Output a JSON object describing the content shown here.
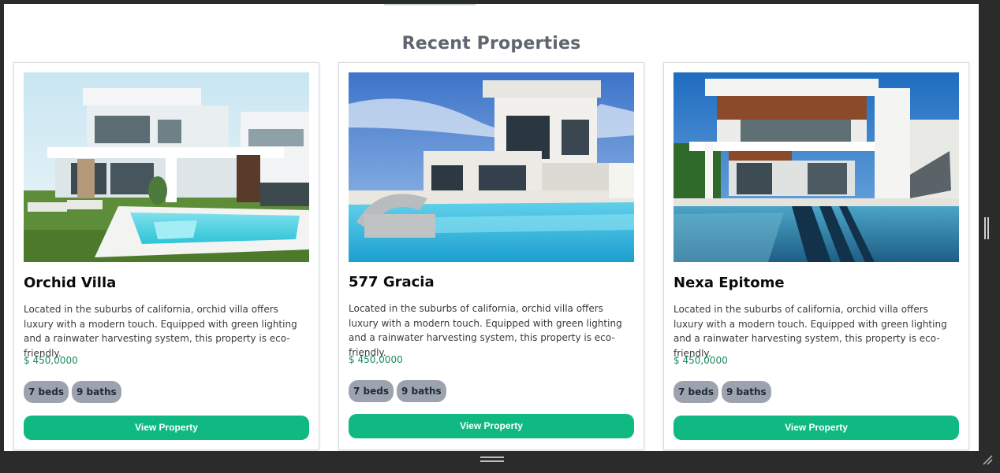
{
  "section_title": "Recent Properties",
  "colors": {
    "button": "#10b981",
    "price": "#1a8a5a",
    "tag_bg": "#9ca3af",
    "title": "#5f6670"
  },
  "properties": [
    {
      "name": "Orchid Villa",
      "description": "Located in the suburbs of california, orchid villa offers luxury with a modern touch. Equipped with green lighting and a rainwater harvesting system, this property is eco-friendly.",
      "price": "$ 450,0000",
      "beds": "7 beds",
      "baths": "9 baths",
      "button_label": "View Property"
    },
    {
      "name": "577 Gracia",
      "description": "Located in the suburbs of california, orchid villa offers luxury with a modern touch. Equipped with green lighting and a rainwater harvesting system, this property is eco-friendly.",
      "price": "$ 450,0000",
      "beds": "7 beds",
      "baths": "9 baths",
      "button_label": "View Property"
    },
    {
      "name": "Nexa Epitome",
      "description": "Located in the suburbs of california, orchid villa offers luxury with a modern touch. Equipped with green lighting and a rainwater harvesting system, this property is eco-friendly.",
      "price": "$ 450,0000",
      "beds": "7 beds",
      "baths": "9 baths",
      "button_label": "View Property"
    }
  ]
}
